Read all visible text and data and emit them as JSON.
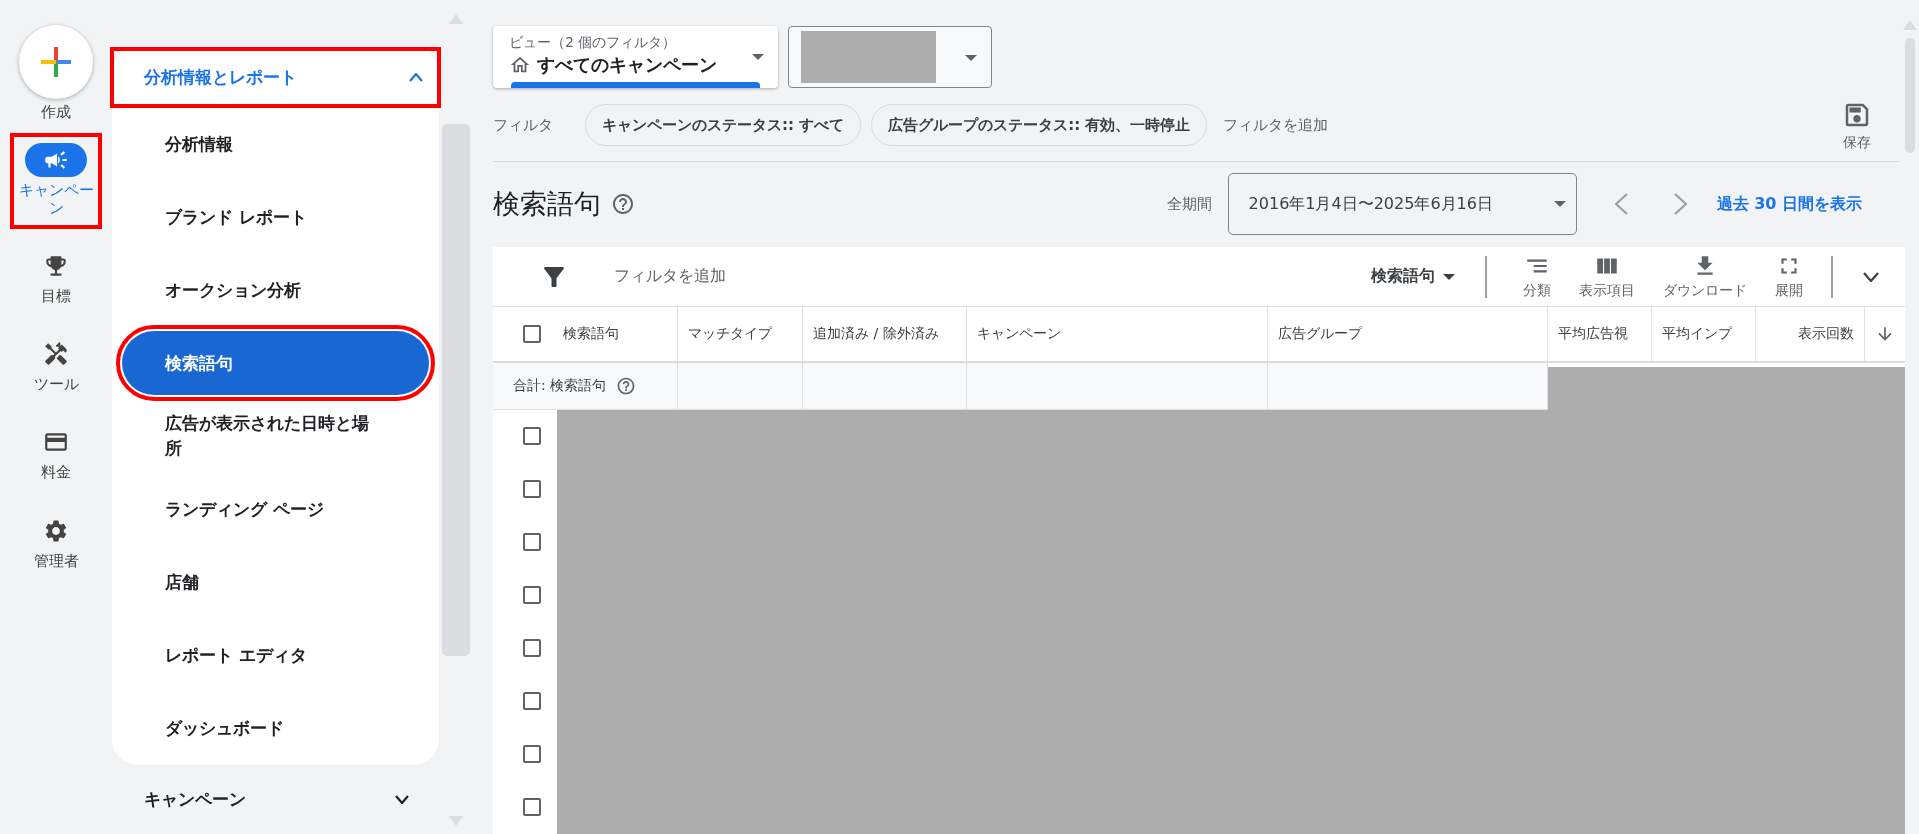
{
  "rail": {
    "create": {
      "label": "作成"
    },
    "items": [
      {
        "kind": "campaigns",
        "label": "キャンペーン",
        "selected": true,
        "highlighted": true
      },
      {
        "kind": "goals",
        "label": "目標",
        "selected": false,
        "highlighted": false
      },
      {
        "kind": "tools",
        "label": "ツール",
        "selected": false,
        "highlighted": false
      },
      {
        "kind": "billing",
        "label": "料金",
        "selected": false,
        "highlighted": false
      },
      {
        "kind": "admin",
        "label": "管理者",
        "selected": false,
        "highlighted": false
      }
    ]
  },
  "nav": {
    "section": {
      "label": "分析情報とレポート",
      "expanded": true,
      "highlighted": true
    },
    "items": [
      {
        "label": "分析情報",
        "selected": false,
        "highlighted": false
      },
      {
        "label": "ブランド レポート",
        "selected": false,
        "highlighted": false
      },
      {
        "label": "オークション分析",
        "selected": false,
        "highlighted": false
      },
      {
        "label": "検索語句",
        "selected": true,
        "highlighted": true
      },
      {
        "label": "広告が表示された日時と場所",
        "selected": false,
        "highlighted": false
      },
      {
        "label": "ランディング ページ",
        "selected": false,
        "highlighted": false
      },
      {
        "label": "店舗",
        "selected": false,
        "highlighted": false
      },
      {
        "label": "レポート エディタ",
        "selected": false,
        "highlighted": false
      },
      {
        "label": "ダッシュボード",
        "selected": false,
        "highlighted": false
      }
    ],
    "next_section": {
      "label": "キャンペーン",
      "expanded": false
    }
  },
  "view_selector": {
    "caption": "ビュー（2 個のフィルタ）",
    "value": "すべてのキャンペーン"
  },
  "filters": {
    "label": "フィルタ",
    "chips": [
      "キャンペーンのステータス:: すべて",
      "広告グループのステータス:: 有効、一時停止"
    ],
    "add": "フィルタを追加"
  },
  "save": {
    "label": "保存"
  },
  "page": {
    "title": "検索語句",
    "period_label": "全期間",
    "date_range": "2016年1月4日〜2025年6月16日",
    "last_30": "過去 30 日間を表示"
  },
  "toolbar": {
    "add_filter": "フィルタを追加",
    "segment": "検索語句",
    "actions": [
      {
        "kind": "segment",
        "label": "分類"
      },
      {
        "kind": "columns",
        "label": "表示項目"
      },
      {
        "kind": "download",
        "label": "ダウンロード"
      },
      {
        "kind": "expand",
        "label": "展開"
      }
    ]
  },
  "table": {
    "columns": [
      {
        "label": "検索語句"
      },
      {
        "label": "マッチタイプ"
      },
      {
        "label": "追加済み / 除外済み"
      },
      {
        "label": "キャンペーン"
      },
      {
        "label": "広告グループ"
      },
      {
        "label": "平均広告視"
      },
      {
        "label": "平均インプ"
      },
      {
        "label": "表示回数"
      }
    ],
    "select_all_checked": false,
    "total_label": "合計: 検索語句",
    "rows": [
      {
        "checked": false
      },
      {
        "checked": false
      },
      {
        "checked": false
      },
      {
        "checked": false
      },
      {
        "checked": false
      },
      {
        "checked": false
      },
      {
        "checked": false
      },
      {
        "checked": false
      }
    ]
  }
}
